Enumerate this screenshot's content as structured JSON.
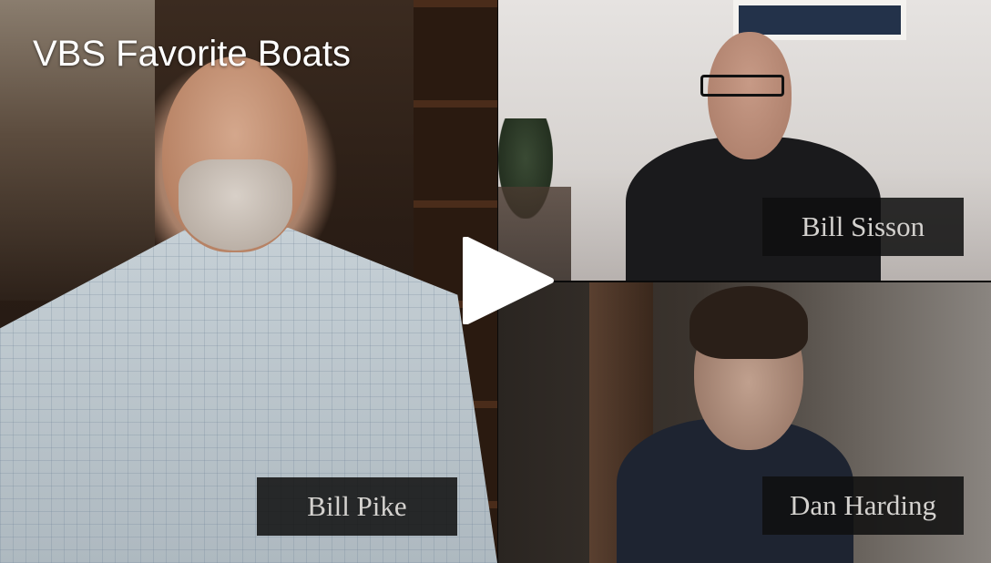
{
  "video": {
    "title": "VBS Favorite Boats",
    "play_icon": "play-icon"
  },
  "participants": [
    {
      "name": "Bill Pike"
    },
    {
      "name": "Bill Sisson"
    },
    {
      "name": "Dan Harding"
    }
  ],
  "colors": {
    "title_text": "#ffffff",
    "nameplate_bg": "#0f0f0f",
    "nameplate_text": "#d4d2cf",
    "play_icon": "#ffffff"
  }
}
